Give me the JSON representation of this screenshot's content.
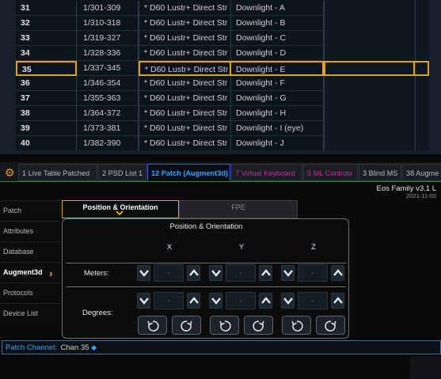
{
  "patch_table": {
    "rows": [
      {
        "channel": "31",
        "address": "1/301-309",
        "type": "* D60 Lustr+ Direct Str",
        "label": "Downlight - A",
        "selected": false
      },
      {
        "channel": "32",
        "address": "1/310-318",
        "type": "* D60 Lustr+ Direct Str",
        "label": "Downlight - B",
        "selected": false
      },
      {
        "channel": "33",
        "address": "1/319-327",
        "type": "* D60 Lustr+ Direct Str",
        "label": "Downlight - C",
        "selected": false
      },
      {
        "channel": "34",
        "address": "1/328-336",
        "type": "* D60 Lustr+ Direct Str",
        "label": "Downlight - D",
        "selected": false
      },
      {
        "channel": "35",
        "address": "1/337-345",
        "type": "* D60 Lustr+ Direct Str",
        "label": "Downlight - E",
        "selected": true
      },
      {
        "channel": "36",
        "address": "1/346-354",
        "type": "* D60 Lustr+ Direct Str",
        "label": "Downlight - F",
        "selected": false
      },
      {
        "channel": "37",
        "address": "1/355-363",
        "type": "* D60 Lustr+ Direct Str",
        "label": "Downlight - G",
        "selected": false
      },
      {
        "channel": "38",
        "address": "1/364-372",
        "type": "* D60 Lustr+ Direct Str",
        "label": "Downlight - H",
        "selected": false
      },
      {
        "channel": "39",
        "address": "1/373-381",
        "type": "* D60 Lustr+ Direct Str",
        "label": "Downlight - I (eye)",
        "selected": false
      },
      {
        "channel": "40",
        "address": "1/382-390",
        "type": "* D60 Lustr+ Direct Str",
        "label": "Downlight - J",
        "selected": false
      }
    ]
  },
  "tabs": [
    {
      "label": "1 Live Table Patched",
      "active": false,
      "color": "normal"
    },
    {
      "label": "2 PSD List 1",
      "active": false,
      "color": "normal"
    },
    {
      "label": "12 Patch (Augment3d)",
      "active": true,
      "color": "normal"
    },
    {
      "label": "7 Virtual Keyboard",
      "active": false,
      "color": "magenta"
    },
    {
      "label": "5 ML Controls",
      "active": false,
      "color": "magenta"
    },
    {
      "label": "3 Blind MS",
      "active": false,
      "color": "normal"
    },
    {
      "label": "38 Augme",
      "active": false,
      "color": "normal"
    }
  ],
  "header": {
    "app": "Eos Family v3.1 L",
    "date": "2021-11-02"
  },
  "nav": [
    {
      "label": "Patch",
      "active": false
    },
    {
      "label": "Attributes",
      "active": false
    },
    {
      "label": "Database",
      "active": false
    },
    {
      "label": "Augment3d",
      "active": true
    },
    {
      "label": "Protocols",
      "active": false
    },
    {
      "label": "Device List",
      "active": false
    }
  ],
  "subtabs": {
    "position": "Position & Orientation",
    "fpe": "FPE"
  },
  "panel": {
    "title": "Position & Orientation",
    "axes": [
      "X",
      "Y",
      "Z"
    ],
    "meters_label": "Meters:",
    "degrees_label": "Degrees:",
    "meters_values": [
      "-",
      "-",
      "-"
    ],
    "degrees_values": [
      "-",
      "-",
      "-"
    ]
  },
  "command_line": {
    "label": "Patch Channel:",
    "value": "Chan 35",
    "marker": "◆"
  },
  "colors": {
    "accent_orange": "#e3a21a",
    "accent_blue": "#3aa1ff",
    "magenta_tab": "#c1329b"
  },
  "icons": {
    "gear": "gear-icon",
    "chevron_down": "chevron-down-icon",
    "chevron_up": "chevron-up-icon",
    "rotate_ccw": "rotate-ccw-icon",
    "rotate_cw": "rotate-cw-icon",
    "chevron_right": "chevron-right-icon"
  }
}
